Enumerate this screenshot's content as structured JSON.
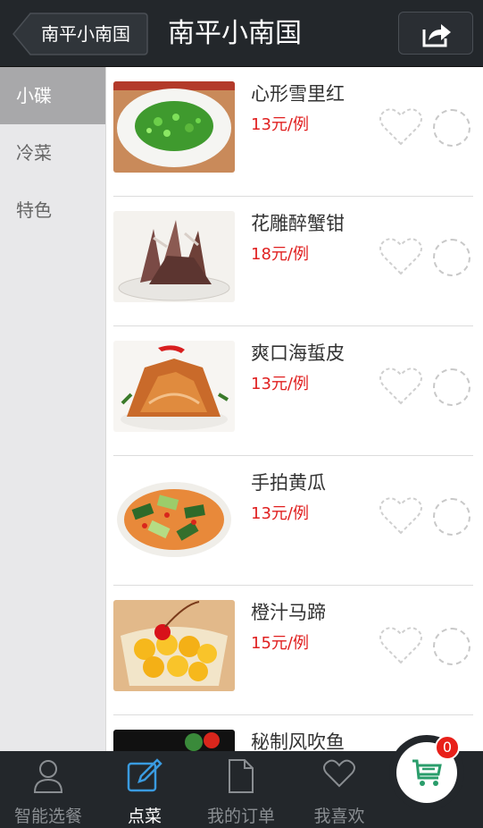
{
  "header": {
    "back_label": "南平小南国",
    "title": "南平小南国"
  },
  "sidebar": {
    "items": [
      {
        "label": "小碟",
        "active": true
      },
      {
        "label": "冷菜",
        "active": false
      },
      {
        "label": "特色",
        "active": false
      }
    ]
  },
  "dishes": [
    {
      "name": "心形雪里红",
      "price": "13元/例",
      "image": "green-vegetable-plate"
    },
    {
      "name": "花雕醉蟹钳",
      "price": "18元/例",
      "image": "drunken-crab-claws"
    },
    {
      "name": "爽口海蜇皮",
      "price": "13元/例",
      "image": "jellyfish-salad"
    },
    {
      "name": "手拍黄瓜",
      "price": "13元/例",
      "image": "smashed-cucumber"
    },
    {
      "name": "橙汁马蹄",
      "price": "15元/例",
      "image": "orange-water-chestnut"
    },
    {
      "name": "秘制风吹鱼",
      "price": "",
      "image": "wind-dried-fish"
    }
  ],
  "tabbar": {
    "items": [
      {
        "label": "智能选餐",
        "icon": "user-icon",
        "active": false
      },
      {
        "label": "点菜",
        "icon": "edit-icon",
        "active": true
      },
      {
        "label": "我的订单",
        "icon": "document-icon",
        "active": false
      },
      {
        "label": "我喜欢",
        "icon": "heart-icon",
        "active": false
      }
    ]
  },
  "cart": {
    "count": "0",
    "icon": "cart-icon"
  },
  "colors": {
    "header_bg": "#23272b",
    "price": "#e02020",
    "active_category_bg": "#a8a8aa",
    "active_tab_icon": "#3a9be0",
    "cart_icon": "#2a9d6b",
    "badge": "#e8201a"
  }
}
